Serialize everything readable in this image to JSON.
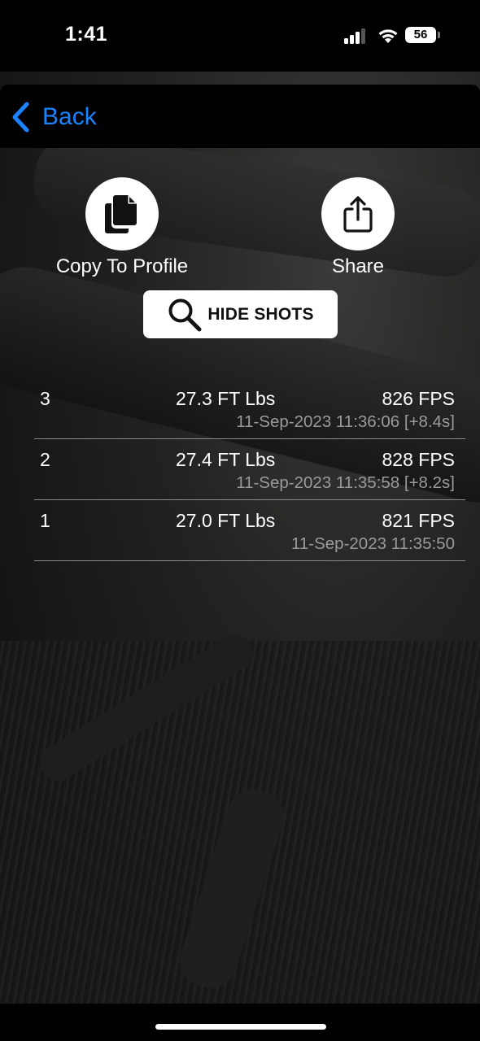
{
  "status_bar": {
    "time": "1:41",
    "battery": "56"
  },
  "nav": {
    "back_label": "Back",
    "accent_color": "#1a84ff"
  },
  "actions": {
    "copy_label": "Copy To Profile",
    "share_label": "Share",
    "hide_shots_label": "HIDE SHOTS"
  },
  "shots": [
    {
      "number": "3",
      "energy": "27.3 FT Lbs",
      "fps": "826 FPS",
      "timestamp": "11-Sep-2023 11:36:06 [+8.4s]"
    },
    {
      "number": "2",
      "energy": "27.4 FT Lbs",
      "fps": "828 FPS",
      "timestamp": "11-Sep-2023 11:35:58 [+8.2s]"
    },
    {
      "number": "1",
      "energy": "27.0 FT Lbs",
      "fps": "821 FPS",
      "timestamp": "11-Sep-2023 11:35:50"
    }
  ]
}
